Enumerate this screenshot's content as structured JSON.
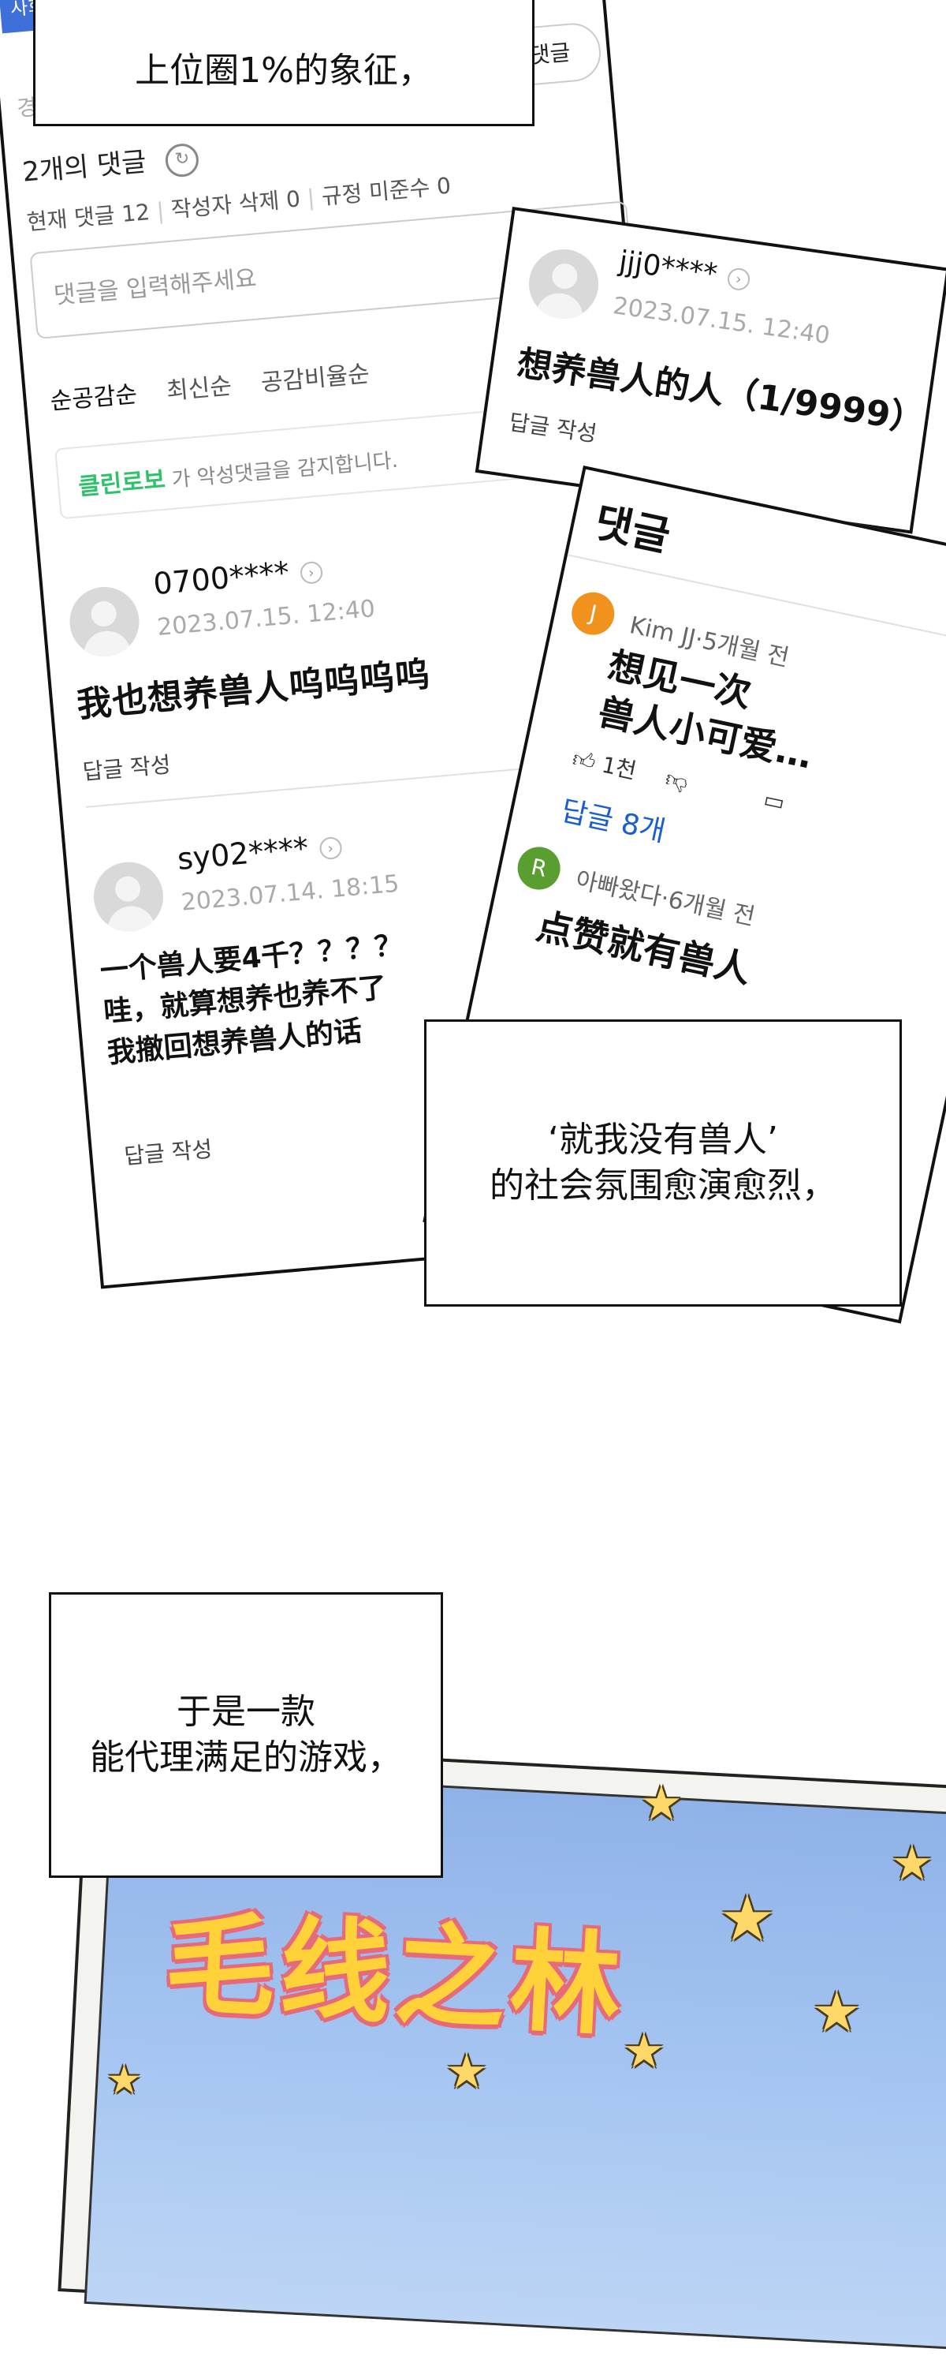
{
  "top_caption": {
    "text": "上位圈1%的象征，"
  },
  "main_card": {
    "tab_fragment": "사회",
    "info_icon": "info-icon",
    "left_edge_fragment": "경우",
    "comment_button": "댓글",
    "count_title": "2개의 댓글",
    "refresh_icon": "refresh-icon",
    "stats": [
      "현재 댓글 12",
      "작성자 삭제 0",
      "규정 미준수 0"
    ],
    "input_placeholder": "댓글을 입력해주세요",
    "sort_tabs": [
      "순공감순",
      "최신순",
      "공감비율순"
    ],
    "cleanbot": {
      "brand": "클린로보",
      "text": " 가 악성댓글을 감지합니다."
    },
    "comments": [
      {
        "user": "0700****",
        "time": "2023.07.15. 12:40",
        "body": "我也想养兽人呜呜呜呜",
        "reply": "답글 작성"
      },
      {
        "user": "sy02****",
        "time": "2023.07.14. 18:15",
        "body": "一个兽人要4千？？？？\n哇，就算想养也养不了\n我撤回想养兽人的话",
        "reply": "답글 작성"
      }
    ]
  },
  "popup_card": {
    "user": "jjj0****",
    "time": "2023.07.15. 12:40",
    "body": "想养兽人的人（1/9999）",
    "reply": "답글 작성"
  },
  "yt_card": {
    "title": "댓글",
    "comments": [
      {
        "avatar_letter": "J",
        "avatar_color": "#f0921c",
        "meta": "Kim JJ·5개월 전",
        "body": "想见一次\n兽人小可爱…",
        "likes": "1천",
        "replies": "답글 8개"
      },
      {
        "avatar_letter": "R",
        "avatar_color": "#5a9e2f",
        "meta": "아빠왔다·6개월 전",
        "body": "点赞就有兽人"
      }
    ]
  },
  "mid_caption": {
    "text": "‘就我没有兽人’\n的社会氛围愈演愈烈，"
  },
  "bottom_caption": {
    "text": "于是一款\n能代理满足的游戏，"
  },
  "game_title": {
    "text": "毛线之林"
  },
  "colors": {
    "cleanbot_green": "#2fc26b",
    "reply_blue": "#1a5fd0",
    "sky": "#8fb8ee"
  }
}
